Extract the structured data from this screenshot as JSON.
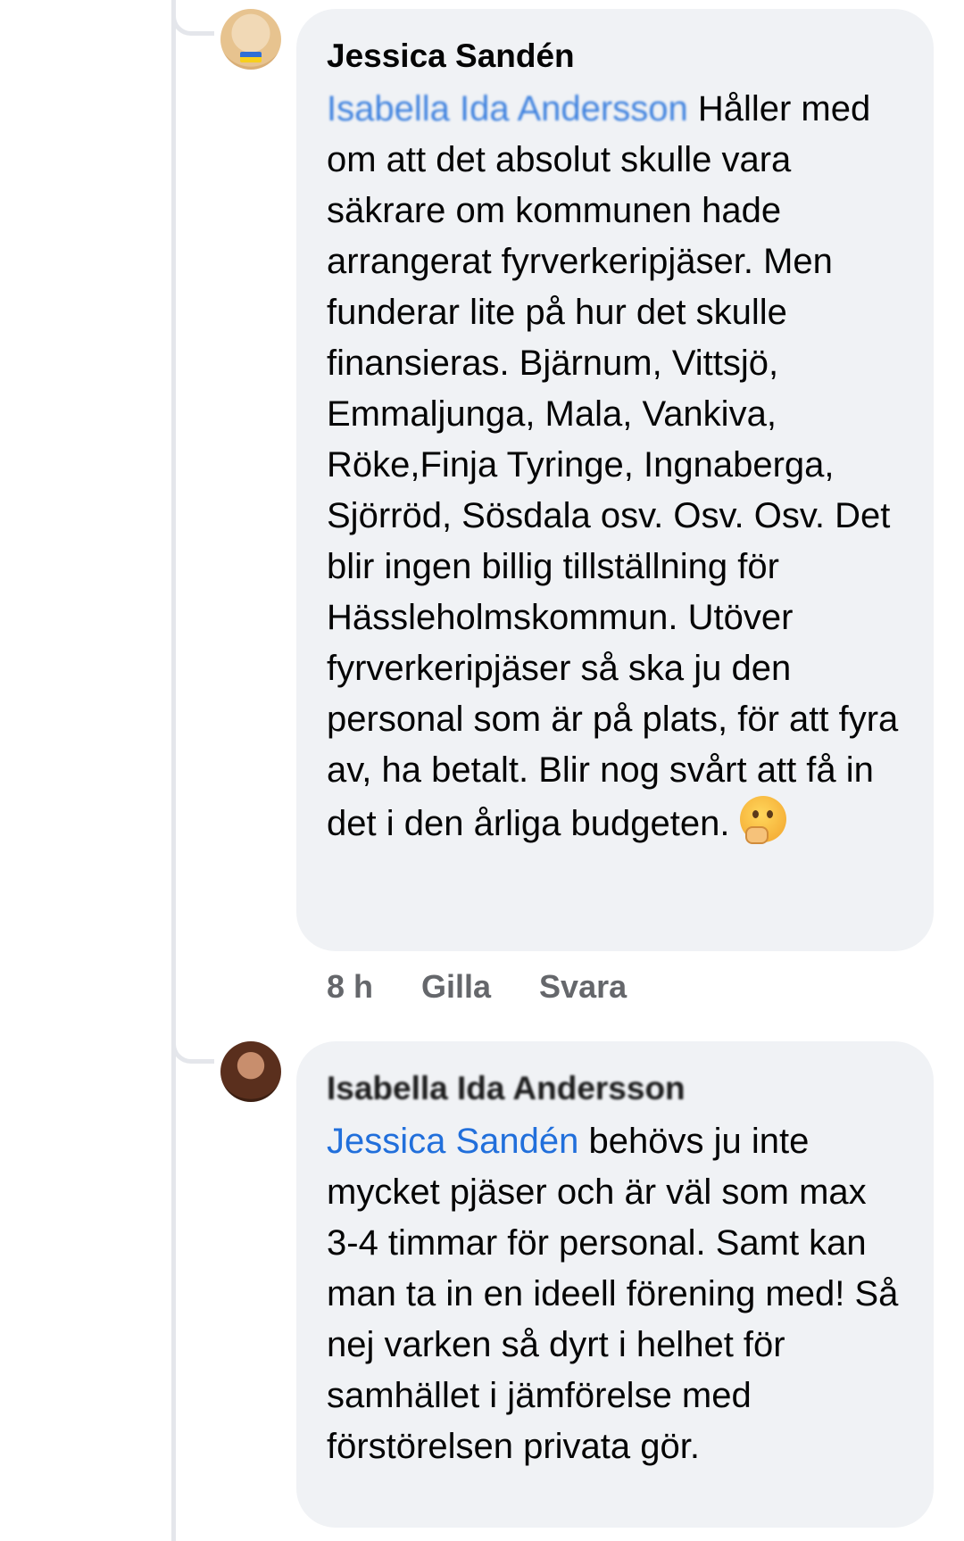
{
  "comments": [
    {
      "author": "Jessica Sandén",
      "mention": "Isabella Ida Andersson",
      "text_after_mention": " Håller med om att det absolut skulle vara säkrare om kommunen hade arrangerat fyrverkeripjäser. Men funderar lite på hur det skulle finansieras. Bjärnum, Vittsjö, Emmaljunga, Mala, Vankiva, Röke,Finja Tyringe, Ingnaberga, Sjörröd, Sösdala osv. Osv. Osv. Det blir ingen billig tillställning för Hässleholmskommun. Utöver fyrverkeripjäser så ska ju den personal som är på plats, för att fyra av, ha betalt. Blir nog svårt att få in det i den årliga budgeten. ",
      "emoji_icon": "thinking-face-icon",
      "timestamp": "8 h",
      "like_label": "Gilla",
      "reply_label": "Svara"
    },
    {
      "author": "Isabella Ida Andersson",
      "mention": "Jessica Sandén",
      "text_after_mention": " behövs ju inte mycket pjäser och är väl som max 3-4 timmar för personal. Samt kan man ta in en ideell förening med! Så nej varken så dyrt i helhet för samhället i jämförelse med förstörelsen privata gör."
    }
  ],
  "colors": {
    "bubble": "#f0f2f5",
    "mention": "#216fdb",
    "meta": "#65676b"
  }
}
